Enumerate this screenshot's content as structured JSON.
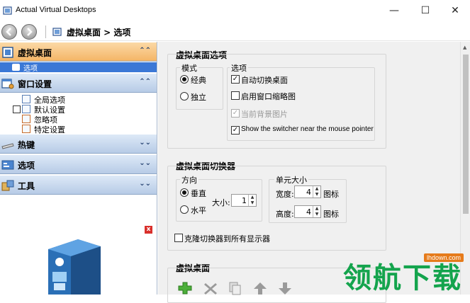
{
  "window": {
    "title": "Actual Virtual Desktops",
    "minimize": "—",
    "maximize": "☐",
    "close": "✕"
  },
  "toolbar": {
    "breadcrumb": "虚拟桌面 > 选项"
  },
  "sidebar": {
    "sections": [
      {
        "label": "虚拟桌面",
        "icon": "desktop-icon",
        "expanded": true,
        "chevron": "⌃⌃"
      },
      {
        "label": "窗口设置",
        "icon": "window-settings-icon",
        "expanded": true,
        "chevron": "⌃⌃"
      },
      {
        "label": "热键",
        "icon": "keyboard-icon",
        "expanded": false,
        "chevron": "⌄⌄"
      },
      {
        "label": "选项",
        "icon": "options-icon",
        "expanded": false,
        "chevron": "⌄⌄"
      },
      {
        "label": "工具",
        "icon": "tools-icon",
        "expanded": false,
        "chevron": "⌄⌄"
      }
    ],
    "desktop_items": [
      {
        "label": "选项",
        "selected": true
      }
    ],
    "window_items": [
      "全局选项",
      "默认设置",
      "忽略项",
      "特定设置"
    ],
    "promo_close": "x"
  },
  "options_group": {
    "title": "虚拟桌面选项",
    "mode": {
      "legend": "模式",
      "options": [
        "经典",
        "独立"
      ],
      "selected": "经典"
    },
    "opts": {
      "legend": "选项",
      "items": [
        {
          "label": "自动切换桌面",
          "checked": true,
          "disabled": false
        },
        {
          "label": "启用窗口缩略图",
          "checked": false,
          "disabled": false
        },
        {
          "label": "当前背景图片",
          "checked": true,
          "disabled": true
        },
        {
          "label": "Show the switcher near the mouse pointer",
          "checked": true,
          "disabled": false
        }
      ]
    }
  },
  "switcher_group": {
    "title": "虚拟桌面切换器",
    "direction": {
      "legend": "方向",
      "options": [
        "垂直",
        "水平"
      ],
      "selected": "垂直",
      "size_label": "大小:",
      "size_value": "1"
    },
    "cell": {
      "legend": "单元大小",
      "width_label": "宽度:",
      "width_value": "4",
      "height_label": "高度:",
      "height_value": "4",
      "unit": "图标"
    },
    "clone_label": "克隆切换器到所有显示器",
    "clone_checked": false
  },
  "desktops_group": {
    "title": "虚拟桌面"
  },
  "watermark": {
    "text": "领航下载",
    "url": "lhdown.com"
  }
}
